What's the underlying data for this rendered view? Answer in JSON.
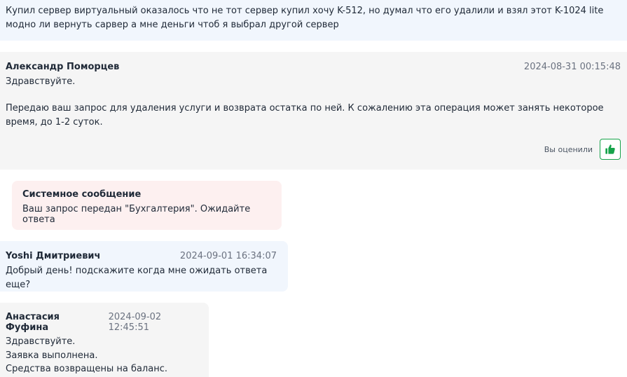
{
  "messages": {
    "first_user": {
      "text": "Купил сервер виртуальный оказалось что не тот сервер купил хочу K-512, но думал что его удалили и взял этот K-1024 lite модно ли вернуть сарвер а мне деньги чтоб я выбрал другой сервер"
    },
    "support_reply": {
      "author": "Александр Поморцев",
      "time": "2024-08-31 00:15:48",
      "greeting": "Здравствуйте.",
      "body": "Передаю ваш запрос для удаления услуги и возврата остатка по ней. К сожалению эта операция может занять некоторое время, до 1-2 суток.",
      "rated_label": "Вы оценили",
      "rating_icon": "thumbs-up-icon"
    },
    "system": {
      "title": "Системное сообщение",
      "body": "Ваш запрос передан \"Бухгалтерия\". Ожидайте ответа"
    },
    "user_followup": {
      "author": "Yoshi Дмитриевич",
      "time": "2024-09-01 16:34:07",
      "body": "Добрый день! подскажите когда мне ожидать ответа еще?"
    },
    "support_final": {
      "author": "Анастасия Фуфина",
      "time": "2024-09-02 12:45:51",
      "lines": [
        "Здравствуйте.",
        "Заявка выполнена.",
        "Средства возвращены на баланс."
      ]
    }
  },
  "colors": {
    "user_bg": "#f1f6fd",
    "support_bg": "#f5f5f5",
    "system_bg": "#fdf0f0",
    "like_green": "#16a34a"
  }
}
